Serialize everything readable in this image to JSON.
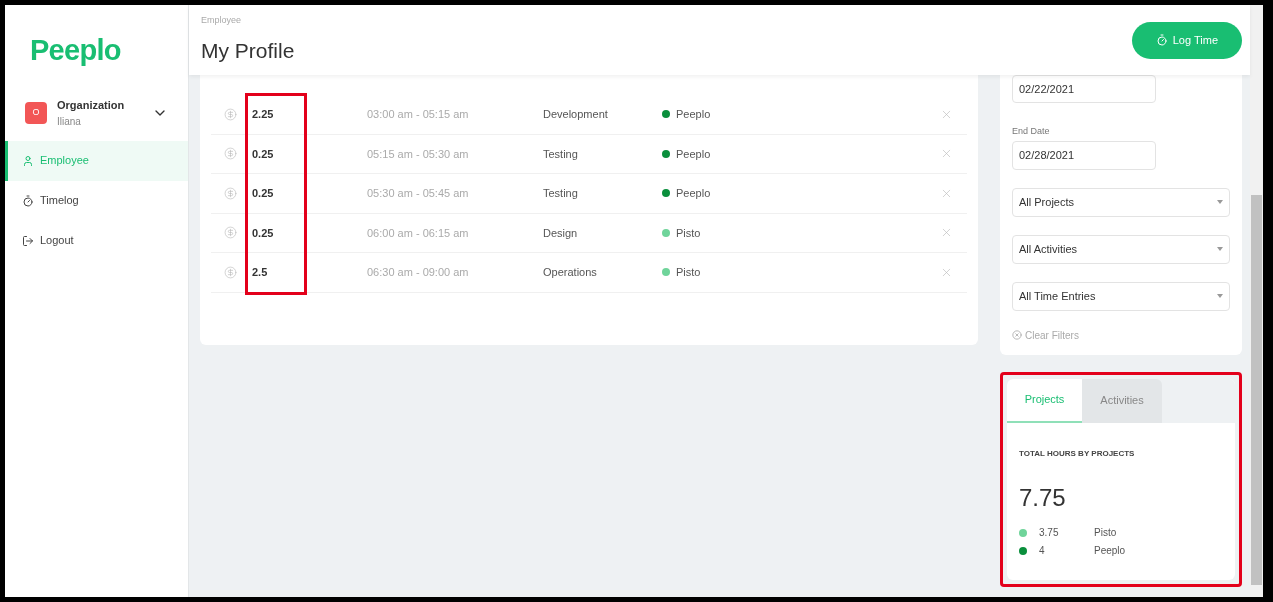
{
  "brand": "Peeplo",
  "organization": {
    "initial": "O",
    "name": "Organization",
    "user": "Iliana"
  },
  "nav": [
    {
      "label": "Employee",
      "kind": "profile",
      "selected": true
    },
    {
      "label": "Timelog",
      "kind": "timelog",
      "selected": false
    },
    {
      "label": "Logout",
      "kind": "logout",
      "selected": false
    }
  ],
  "header": {
    "breadcrumb": "Employee",
    "title": "My Profile",
    "log_time_button": "Log Time"
  },
  "entries": [
    {
      "hours": "2.25",
      "time": "03:00 am - 05:15 am",
      "activity": "Development",
      "project": "Peeplo",
      "color": "#0a8f3c"
    },
    {
      "hours": "0.25",
      "time": "05:15 am - 05:30 am",
      "activity": "Testing",
      "project": "Peeplo",
      "color": "#0a8f3c"
    },
    {
      "hours": "0.25",
      "time": "05:30 am - 05:45 am",
      "activity": "Testing",
      "project": "Peeplo",
      "color": "#0a8f3c"
    },
    {
      "hours": "0.25",
      "time": "06:00 am - 06:15 am",
      "activity": "Design",
      "project": "Pisto",
      "color": "#6fd49a"
    },
    {
      "hours": "2.5",
      "time": "06:30 am - 09:00 am",
      "activity": "Operations",
      "project": "Pisto",
      "color": "#6fd49a"
    }
  ],
  "hours_highlighted": true,
  "filters": {
    "start_date": "02/22/2021",
    "end_date_label": "End Date",
    "end_date": "02/28/2021",
    "selects": [
      "All Projects",
      "All Activities",
      "All Time Entries"
    ],
    "clear": "Clear Filters"
  },
  "summary": {
    "highlighted": true,
    "tabs": [
      {
        "label": "Projects",
        "selected": true
      },
      {
        "label": "Activities",
        "selected": false
      }
    ],
    "heading": "TOTAL HOURS BY PROJECTS",
    "total": "7.75",
    "items": [
      {
        "value": "3.75",
        "name": "Pisto",
        "color": "#6fd49a"
      },
      {
        "value": "4",
        "name": "Peeplo",
        "color": "#0a8f3c"
      }
    ]
  }
}
